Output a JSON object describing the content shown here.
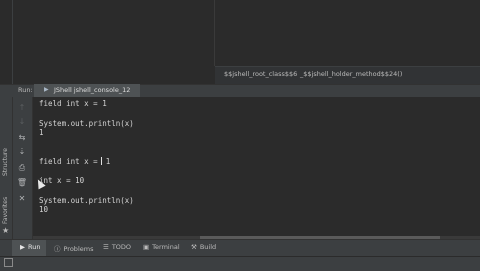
{
  "breadcrumb": {
    "items": [
      "$$jshell_root_class$$6",
      "_$$jshell_holder_method$$24()"
    ],
    "separator": "›"
  },
  "run_panel": {
    "label": "Run:",
    "tab_label": "JShell jshell_console_12"
  },
  "side_labels": [
    "Structure",
    "Favorites"
  ],
  "toolbar_icons": [
    "arrow-up-icon",
    "arrow-down-icon",
    "soft-wrap-icon",
    "sort-icon",
    "print-icon",
    "trash-icon",
    "close-icon"
  ],
  "console": {
    "lines": [
      "field int x = 1",
      "",
      "System.out.println(x)",
      "1",
      "",
      "",
      "field int x = 1",
      "",
      "int x = 10",
      "",
      "System.out.println(x)",
      "10"
    ],
    "edit_line_before_caret": "field int x = ",
    "edit_line_after_caret": " 1"
  },
  "bottom_tabs": [
    {
      "label": "Run",
      "icon": "play-icon",
      "active": true
    },
    {
      "label": "Problems",
      "icon": "info-icon"
    },
    {
      "label": "TODO",
      "icon": "list-icon"
    },
    {
      "label": "Terminal",
      "icon": "terminal-icon"
    },
    {
      "label": "Build",
      "icon": "hammer-icon"
    }
  ],
  "colors": {
    "background": "#2b2b2b",
    "panel": "#3c3f41",
    "tab_underline": "#4a88c7"
  }
}
